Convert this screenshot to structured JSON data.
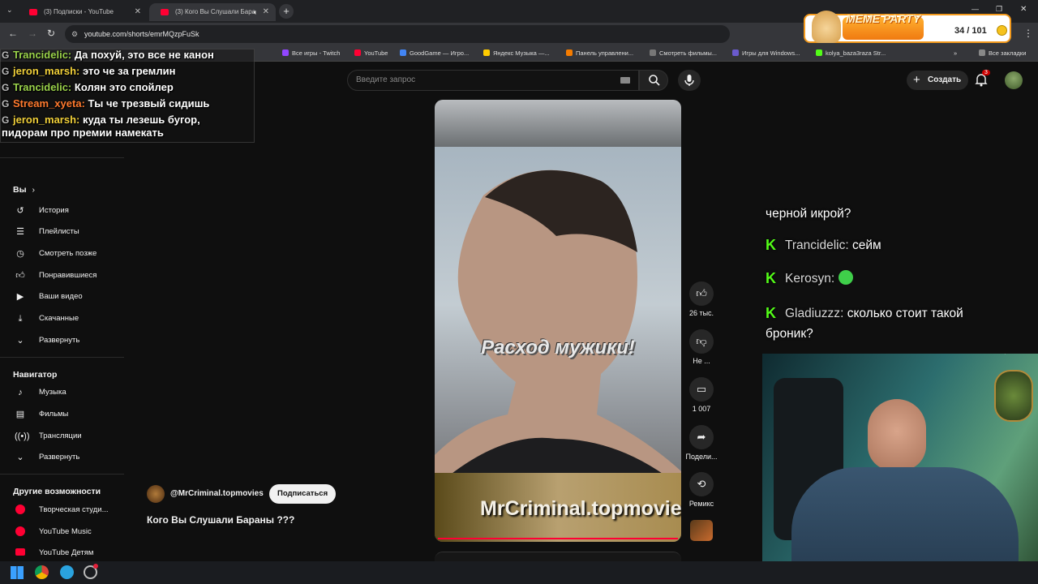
{
  "browser": {
    "tabs": [
      {
        "title": "(3) Подписки - YouTube",
        "active": false
      },
      {
        "title": "(3) Кого Вы Слушали Бара",
        "active": true
      }
    ],
    "url": "youtube.com/shorts/emrMQzpFuSk",
    "bookmarks": [
      {
        "label": "Все игры - Twitch",
        "color": "#9146ff"
      },
      {
        "label": "YouTube",
        "color": "#ff0033"
      },
      {
        "label": "GoodGame — Игро...",
        "color": "#4285f4"
      },
      {
        "label": "Яндекс Музыка —...",
        "color": "#ffcc00"
      },
      {
        "label": "Панель управлени...",
        "color": "#f57c00"
      },
      {
        "label": "Смотреть фильмы...",
        "color": "#777777"
      },
      {
        "label": "Игры для Windows...",
        "color": "#6a5acd"
      },
      {
        "label": "kolya_baza3raza Str...",
        "color": "#53fc18"
      }
    ],
    "all_bookmarks_label": "Все закладки"
  },
  "youtube": {
    "search_placeholder": "Введите запрос",
    "create_label": "Создать",
    "notifications_count": "3",
    "sidebar": {
      "you_heading": "Вы",
      "you_items": [
        {
          "label": "История",
          "icon": "history-icon"
        },
        {
          "label": "Плейлисты",
          "icon": "playlists-icon"
        },
        {
          "label": "Смотреть позже",
          "icon": "clock-icon"
        },
        {
          "label": "Понравившиеся",
          "icon": "thumb-up-icon"
        },
        {
          "label": "Ваши видео",
          "icon": "video-icon"
        },
        {
          "label": "Скачанные",
          "icon": "download-icon"
        },
        {
          "label": "Развернуть",
          "icon": "chevron-down-icon"
        }
      ],
      "navigator_heading": "Навигатор",
      "navigator_items": [
        {
          "label": "Музыка",
          "icon": "music-icon"
        },
        {
          "label": "Фильмы",
          "icon": "film-icon"
        },
        {
          "label": "Трансляции",
          "icon": "live-icon"
        },
        {
          "label": "Развернуть",
          "icon": "chevron-down-icon"
        }
      ],
      "other_heading": "Другие возможности",
      "other_items": [
        {
          "label": "Творческая студи...",
          "icon": "studio-icon"
        },
        {
          "label": "YouTube Music",
          "icon": "yt-music-icon"
        },
        {
          "label": "YouTube Детям",
          "icon": "yt-kids-icon"
        }
      ]
    },
    "short": {
      "overlay_caption": "Расход мужики!",
      "watermark": "MrCriminal.topmovie",
      "channel": "@MrCriminal.topmovies",
      "subscribe_label": "Подписаться",
      "title": "Кого Вы Слушали Бараны ???",
      "likes": "26 тыс.",
      "dislike_label": "Не ...",
      "comments": "1 007",
      "share_label": "Подели...",
      "remix_label": "Ремикс"
    }
  },
  "stream_overlay": {
    "chat": [
      {
        "user": "Trancidelic",
        "text": "Да похуй, это все не канон",
        "color": "#9ad24a"
      },
      {
        "user": "jeron_marsh",
        "text": "это че за гремлин",
        "color": "#f2d13a"
      },
      {
        "user": "Trancidelic",
        "text": "Колян это спойлер",
        "color": "#9ad24a"
      },
      {
        "user": "Stream_xyeta",
        "text": "Ты че трезвый сидишь",
        "color": "#ff7a2e"
      },
      {
        "user": "jeron_marsh",
        "text": "куда ты лезешь бугор,",
        "color": "#f2d13a"
      }
    ],
    "chat_continuation": "пидорам про премии намекать",
    "right_chat_top": "черной икрой?",
    "right_chat": [
      {
        "user": "Trancidelic",
        "text": "сейм"
      },
      {
        "user": "Kerosyn",
        "text": ""
      },
      {
        "user": "Gladiuzzz",
        "text": "сколько стоит такой"
      }
    ],
    "right_chat_cont": "броник?",
    "meme_party": {
      "title": "MEME PARTY",
      "progress": "34 / 101"
    }
  }
}
